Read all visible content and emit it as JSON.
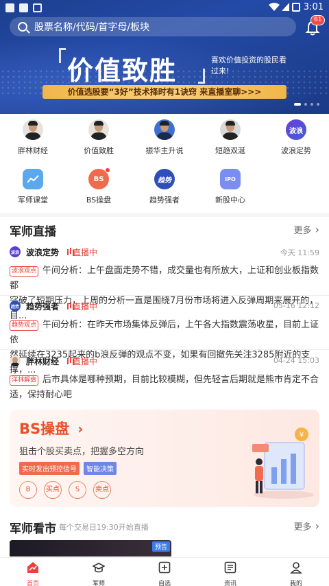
{
  "status": {
    "time": "3:01"
  },
  "search": {
    "placeholder": "股票名称/代码/首字母/板块",
    "badge": "61"
  },
  "banner": {
    "title": "价值致胜",
    "subtitle": "喜欢价值投资的股民看过来!",
    "cta": "价值选股要“3好”技术择时有1诀窍 来直播室聊>>>"
  },
  "grid": [
    {
      "label": "胖林财经",
      "icon": "avatar-person"
    },
    {
      "label": "价值致胜",
      "icon": "avatar-person"
    },
    {
      "label": "振华主升说",
      "icon": "avatar-person"
    },
    {
      "label": "短趋双涎",
      "icon": "avatar-person"
    },
    {
      "label": "波浪定势",
      "icon": "wave-logo"
    },
    {
      "label": "军师课堂",
      "icon": "chart-icon"
    },
    {
      "label": "BS操盘",
      "icon": "bs-icon"
    },
    {
      "label": "趋势强者",
      "icon": "trend-logo"
    },
    {
      "label": "新股中心",
      "icon": "ipo-icon"
    }
  ],
  "live_section": {
    "title": "军师直播",
    "more": "更多"
  },
  "live_items": [
    {
      "name": "波浪定势",
      "status": "直播中",
      "time": "今天 11:59",
      "tag": "波浪观点",
      "line1": "午间分析：上午盘面走势不错，成交量也有所放大，上证和创业板指数都",
      "line2": "突破了短期压力，上周的分析一直是围绕7月份市场将进入反弹周期来展开的，目..."
    },
    {
      "name": "趋势强者",
      "status": "直播中",
      "time": "05-16 12:12",
      "tag": "趋势观点",
      "line1": "午间分析：在昨天市场集体反弹后，上午各大指数震荡收星，目前上证依",
      "line2": "然延续在3235起来的b浪反弹的观点不变，如果有回撤先关注3285附近的支撑，..."
    },
    {
      "name": "胖林财经",
      "status": "直播中",
      "time": "04-24 15:03",
      "tag": "洋林解盘",
      "line1": "后市具体是哪种预期，目前比较模糊，但先轻言后期就是熊市肯定不合",
      "line2": "适，保持耐心吧"
    }
  ],
  "bs_card": {
    "title": "BS操盘",
    "subtitle": "狙击个股买卖点，把握多空方向",
    "chips": [
      "实时发出预控信号",
      "智能决策"
    ],
    "circles": [
      "B",
      "买点",
      "S",
      "卖点"
    ]
  },
  "view_section": {
    "title": "军师看市",
    "subtitle": "每个交易日19:30开始直播",
    "more": "更多",
    "video_tag": "预告"
  },
  "tabs": [
    "首页",
    "军师",
    "自选",
    "资讯",
    "我的"
  ],
  "colors": {
    "primary": "#e8423a",
    "banner": "#234aa6",
    "gold": "#f0b64a"
  }
}
